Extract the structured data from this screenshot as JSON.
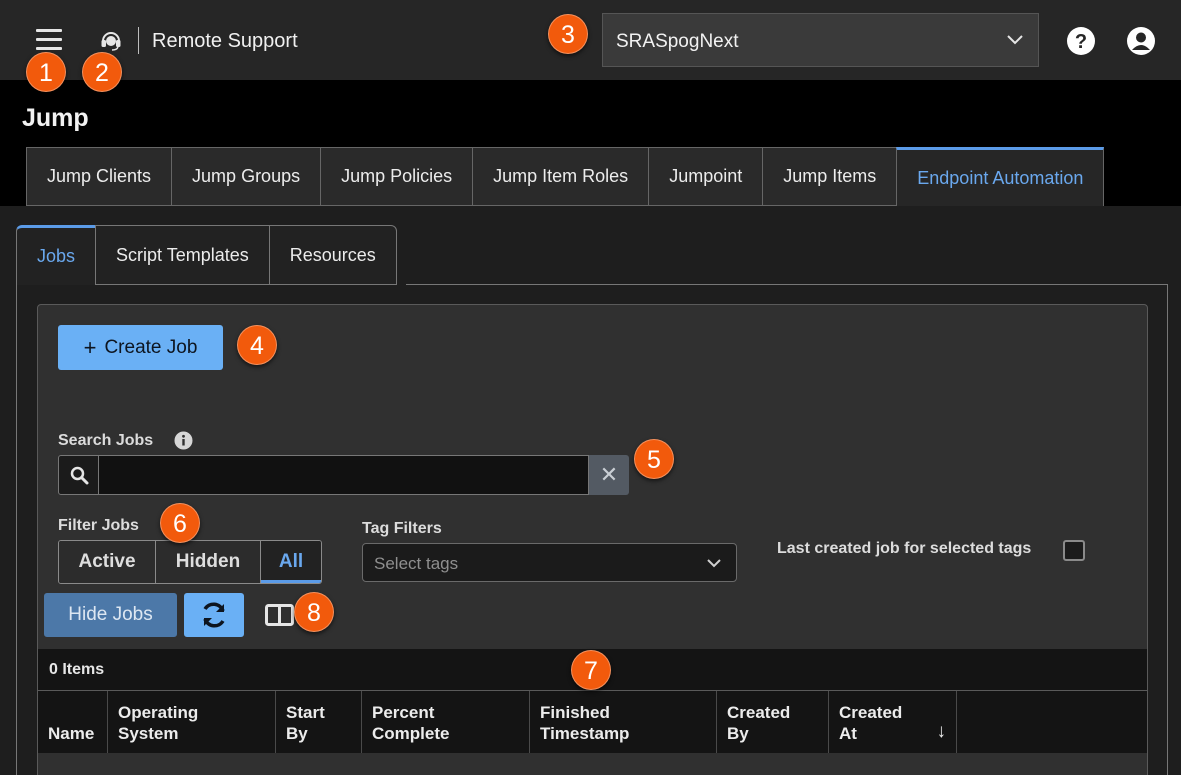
{
  "app": {
    "title": "Remote Support",
    "site_selector": "SRASpogNext",
    "icons": [
      "menu-icon",
      "headset-icon",
      "help-icon",
      "user-icon",
      "chevron-down-icon"
    ]
  },
  "page": {
    "title": "Jump",
    "main_tabs": [
      {
        "label": "Jump Clients"
      },
      {
        "label": "Jump Groups"
      },
      {
        "label": "Jump Policies"
      },
      {
        "label": "Jump Item Roles"
      },
      {
        "label": "Jumpoint"
      },
      {
        "label": "Jump Items"
      },
      {
        "label": "Endpoint Automation",
        "active": true
      }
    ],
    "sub_tabs": [
      {
        "label": "Jobs",
        "active": true
      },
      {
        "label": "Script Templates"
      },
      {
        "label": "Resources"
      }
    ]
  },
  "jobs": {
    "create_label": "Create Job",
    "create_plus": "+",
    "search_label": "Search Jobs",
    "search_value": "",
    "clear_glyph": "✕",
    "filter_label": "Filter Jobs",
    "filters": [
      {
        "label": "Active"
      },
      {
        "label": "Hidden"
      },
      {
        "label": "All",
        "active": true
      }
    ],
    "tag_filters_label": "Tag Filters",
    "tag_placeholder": "Select tags",
    "last_created_label": "Last created job for selected tags",
    "last_created_checked": false,
    "hide_label": "Hide Jobs",
    "items_count": "0 Items",
    "columns": [
      {
        "line1": "Name",
        "line2": ""
      },
      {
        "line1": "Operating",
        "line2": "System"
      },
      {
        "line1": "Start",
        "line2": "By"
      },
      {
        "line1": "Percent",
        "line2": "Complete"
      },
      {
        "line1": "Finished",
        "line2": "Timestamp"
      },
      {
        "line1": "Created",
        "line2": "By"
      },
      {
        "line1": "Created",
        "line2": "At"
      }
    ],
    "sort_glyph": "↓"
  },
  "callouts": [
    "1",
    "2",
    "3",
    "4",
    "5",
    "6",
    "7",
    "8"
  ],
  "colors": {
    "accent": "#6ab0f5",
    "active_tab_text": "#6aa8ee",
    "callout": "#f25a0c",
    "hide_button": "#4c78a8"
  }
}
